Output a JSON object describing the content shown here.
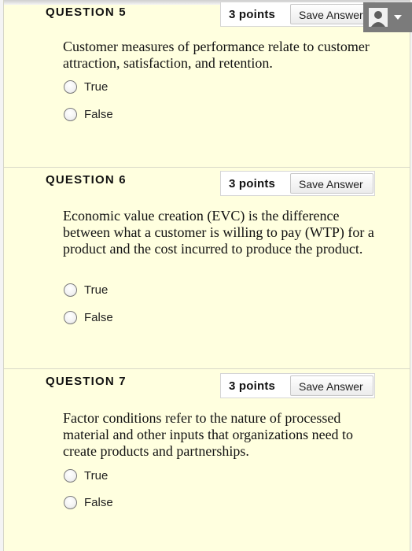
{
  "questions": [
    {
      "title": "QUESTION 5",
      "points": "3 points",
      "save_label": "Save Answer",
      "text": "Customer measures of performance relate to customer attraction, satisfaction, and retention.",
      "options": [
        "True",
        "False"
      ]
    },
    {
      "title": "QUESTION 6",
      "points": "3 points",
      "save_label": "Save Answer",
      "text": "Economic value creation (EVC) is the difference between what a customer is willing to pay (WTP) for a product and the cost incurred to produce the product.",
      "options": [
        "True",
        "False"
      ]
    },
    {
      "title": "QUESTION 7",
      "points": "3 points",
      "save_label": "Save Answer",
      "text": "Factor conditions refer to the nature of processed material and other inputs that organizations need to create products and partnerships.",
      "options": [
        "True",
        "False"
      ]
    }
  ],
  "user_menu": {
    "icon": "user-avatar-icon",
    "chevron": "chevron-down-icon"
  }
}
